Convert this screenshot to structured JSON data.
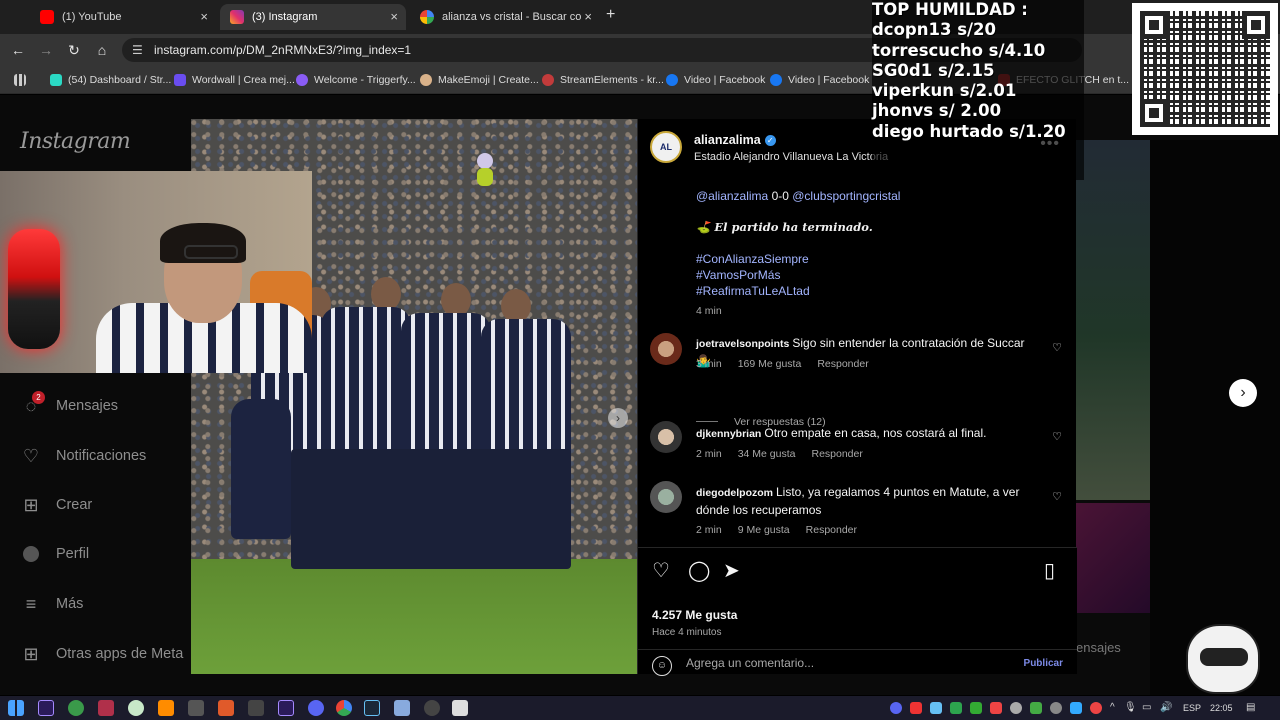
{
  "browser": {
    "tabs": [
      {
        "label": "(1) YouTube",
        "color": "#ff0000"
      },
      {
        "label": "(3) Instagram",
        "color": "#e1306c"
      },
      {
        "label": "alianza vs cristal - Buscar con G",
        "color": "#4285f4"
      }
    ],
    "close_glyph": "×",
    "new_tab_glyph": "+",
    "url": "instagram.com/p/DM_2nRMNxE3/?img_index=1",
    "bookmarks": [
      "(54) Dashboard / Str...",
      "Wordwall | Crea mej...",
      "Welcome - Triggerfy...",
      "MakeEmoji | Create...",
      "StreamElements - kr...",
      "Video | Facebook",
      "Video | Facebook",
      "EFECTO GLITCH en t..."
    ]
  },
  "sidebar": {
    "logo": "Instagram",
    "items": [
      {
        "label": "Mensajes",
        "icon": "messenger-icon"
      },
      {
        "label": "Notificaciones",
        "icon": "heart-icon"
      },
      {
        "label": "Crear",
        "icon": "plus-square-icon"
      },
      {
        "label": "Perfil",
        "icon": "profile-icon"
      },
      {
        "label": "Más",
        "icon": "menu-icon"
      },
      {
        "label": "Otras apps de Meta",
        "icon": "grid-icon"
      }
    ],
    "messages_badge": "2"
  },
  "post": {
    "username": "alianzalima",
    "location": "Estadio Alejandro Villanueva La Victoria",
    "caption": {
      "mention1": "@alianzalima",
      "score": "0-0",
      "mention2": "@clubsportingcristal",
      "ended": "El partido ha terminado.",
      "hashtags": [
        "#ConAlianzaSiempre",
        "#VamosPorMás",
        "#ReafirmaTuLeALtad"
      ],
      "time": "4 min"
    },
    "comments": [
      {
        "user": "joetravelsonpoints",
        "text": "Sigo sin entender la contratación de Succar 🤷‍♂️",
        "time": "3 min",
        "likes": "169 Me gusta",
        "reply": "Responder"
      },
      {
        "user": "djkennybrian",
        "text": "Otro empate en casa, nos costará al final.",
        "time": "2 min",
        "likes": "34 Me gusta",
        "reply": "Responder"
      },
      {
        "user": "diegodelpozom",
        "text": "Listo, ya regalamos 4 puntos en Matute, a ver dónde los recuperamos",
        "time": "2 min",
        "likes": "9 Me gusta",
        "reply": "Responder"
      }
    ],
    "view_replies": "Ver respuestas (12)",
    "likes_total": "4.257 Me gusta",
    "posted_ago": "Hace 4 minutos",
    "comment_placeholder": "Agrega un comentario...",
    "publish_label": "Publicar"
  },
  "background_label": "ensajes",
  "overlay": {
    "title": "TOP HUMILDAD :",
    "donors": [
      "dcopn13 s/20",
      "torrescucho s/4.10",
      "SG0d1 s/2.15",
      "viperkun s/2.01",
      "jhonvs s/ 2.00",
      "diego hurtado s/1.20"
    ]
  },
  "taskbar": {
    "lang": "ESP",
    "time": "22:05"
  },
  "colors": {
    "accent": "#3897f0",
    "link": "#a3b5ff",
    "alianza_navy": "#1c2340"
  }
}
